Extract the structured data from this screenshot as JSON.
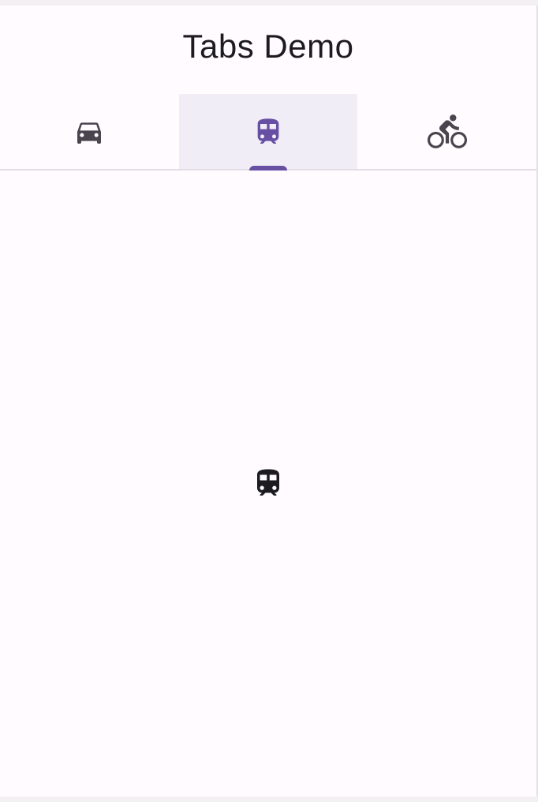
{
  "app_bar": {
    "title": "Tabs Demo"
  },
  "tabs": [
    {
      "icon": "car-icon",
      "selected": false
    },
    {
      "icon": "train-icon",
      "selected": true
    },
    {
      "icon": "bike-icon",
      "selected": false
    }
  ],
  "content": {
    "icon": "train-icon"
  },
  "colors": {
    "accent": "#6750a4",
    "icon_default": "#49454f",
    "selected_tab_bg": "#f1edf6",
    "surface": "#fffbfe",
    "content_icon": "#1c1b1f"
  }
}
